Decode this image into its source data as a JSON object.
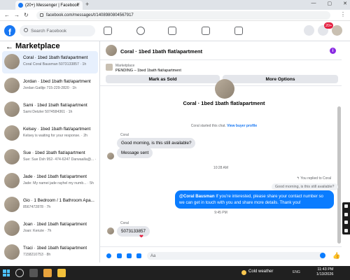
{
  "browser": {
    "tab_title": "(20+) Messenger | Facebook",
    "new_tab": "+",
    "tab_close": "×",
    "url": "facebook.com/messages/t/1408980804567917",
    "window_controls": [
      "—",
      "▢",
      "✕"
    ],
    "nav": {
      "back": "←",
      "forward": "→",
      "reload": "↻"
    },
    "menu": "⋮"
  },
  "fb": {
    "logo": "f",
    "search_placeholder": "Search Facebook",
    "notification_count": "20+"
  },
  "marketplace": {
    "title": "Marketplace",
    "back": "←",
    "conversations": [
      {
        "title": "Coral · 1bed 1bath flat/apartment",
        "subtitle": "Coral Coral Bausman 5073133857 · 1h",
        "active": true
      },
      {
        "title": "Jordan · 1bed 1bath flat/apartment",
        "subtitle": "Jordan Gatlije 715-229-2820 · 1h",
        "active": false
      },
      {
        "title": "Sami · 1bed 1bath flat/apartment",
        "subtitle": "Sami Detzler 5074584361 · 1h",
        "active": false
      },
      {
        "title": "Kelsey · 1bed 1bath flat/apartment",
        "subtitle": "Kelsey is waiting for your response. · 2h",
        "active": false
      },
      {
        "title": "Sue · 1bed 1bath flat/apartment",
        "subtitle": "Sue: Sue Dsh 952- 474-6247 Darwaalla@... · 4h",
        "active": false
      },
      {
        "title": "Jade · 1bed 1bath flat/apartment",
        "subtitle": "Jade: My namei jade rayhel my numb... · 5h",
        "active": false
      },
      {
        "title": "Gio · 1 Bedroom / 1 Bathroom Apa...",
        "subtitle": "8567472878 · 7h",
        "active": false
      },
      {
        "title": "Joan · 1bed 1bath flat/apartment",
        "subtitle": "Joan: Kenzie · 7h",
        "active": false
      },
      {
        "title": "Traci · 1bed 1bath flat/apartment",
        "subtitle": "7158210753 · 8h",
        "active": false
      }
    ]
  },
  "chat": {
    "header_title": "Coral · 1bed 1bath flat/apartment",
    "info_icon": "i",
    "listing_label": "Marketplace",
    "listing_status": "PENDING – 1bed 1bath flat/apartment",
    "mark_sold": "Mark as Sold",
    "more_options": "More Options",
    "center_title": "Coral · 1bed 1bath flat/apartment",
    "started_text": "Coral started this chat.",
    "view_profile": "View buyer profile",
    "sender1": "Coral",
    "msg1": "Good morning, is this still available?",
    "msg2": "Message sent",
    "time1": "10:28 AM",
    "replied_note": "↰ You replied to Coral",
    "quoted": "Good morning, is this still available?",
    "out_mention": "@Coral Bausman",
    "out_text": " If you're interested, please share your contact number so we can get in touch with you and share more details. Thank you!",
    "time2": "9:45 PM",
    "sender2": "Coral",
    "msg3": "5073133857",
    "reaction": "❤",
    "composer_placeholder": "Aa",
    "like": "👍"
  },
  "taskbar": {
    "weather": "Cold weather",
    "tray": "ENG",
    "time": "11:43 PM",
    "date": "1/13/2026"
  },
  "colors": {
    "brand": "#1877f2",
    "outgoing_bubble": "#0a7cff",
    "incoming_bubble": "#e4e6eb",
    "active_conv": "#e7f0fd"
  }
}
